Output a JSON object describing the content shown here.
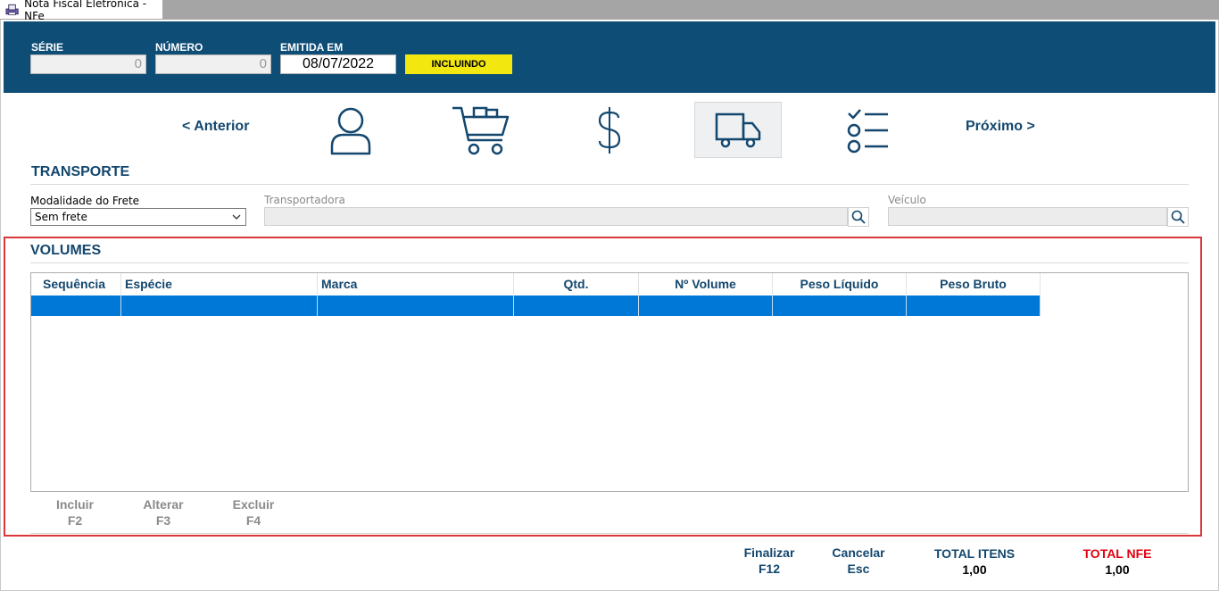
{
  "window": {
    "title": "Nota Fiscal Eletrônica - NFe",
    "icon": "printer-app-icon"
  },
  "header": {
    "serie": {
      "label": "SÉRIE",
      "value": "0"
    },
    "numero": {
      "label": "NÚMERO",
      "value": "0"
    },
    "emitida": {
      "label": "EMITIDA EM",
      "value": "08/07/2022"
    },
    "status": "INCLUINDO",
    "colors": {
      "band": "#0e4d76",
      "status_bg": "#f2e70f"
    }
  },
  "nav": {
    "prev": "< Anterior",
    "next": "Próximo >",
    "steps": [
      "user-icon",
      "cart-icon",
      "dollar-icon",
      "truck-icon",
      "checklist-icon"
    ],
    "active_step": "truck-icon"
  },
  "transporte": {
    "title": "TRANSPORTE",
    "modalidade": {
      "label": "Modalidade do Frete",
      "value": "Sem frete"
    },
    "transportadora": {
      "label": "Transportadora",
      "value": ""
    },
    "veiculo": {
      "label": "Veículo",
      "value": ""
    }
  },
  "volumes": {
    "title": "VOLUMES",
    "columns": [
      "Sequência",
      "Espécie",
      "Marca",
      "Qtd.",
      "Nº Volume",
      "Peso Líquido",
      "Peso Bruto"
    ],
    "rows": [
      [
        "",
        "",
        "",
        "",
        "",
        "",
        ""
      ]
    ],
    "selected_color": "#0078d7",
    "actions": [
      {
        "label": "Incluir",
        "key": "F2"
      },
      {
        "label": "Alterar",
        "key": "F3"
      },
      {
        "label": "Excluir",
        "key": "F4"
      }
    ]
  },
  "footer": {
    "finalizar": {
      "label": "Finalizar",
      "key": "F12"
    },
    "cancelar": {
      "label": "Cancelar",
      "key": "Esc"
    },
    "total_itens": {
      "label": "TOTAL ITENS",
      "value": "1,00"
    },
    "total_nfe": {
      "label": "TOTAL NFE",
      "value": "1,00",
      "color": "#e3000f"
    }
  }
}
